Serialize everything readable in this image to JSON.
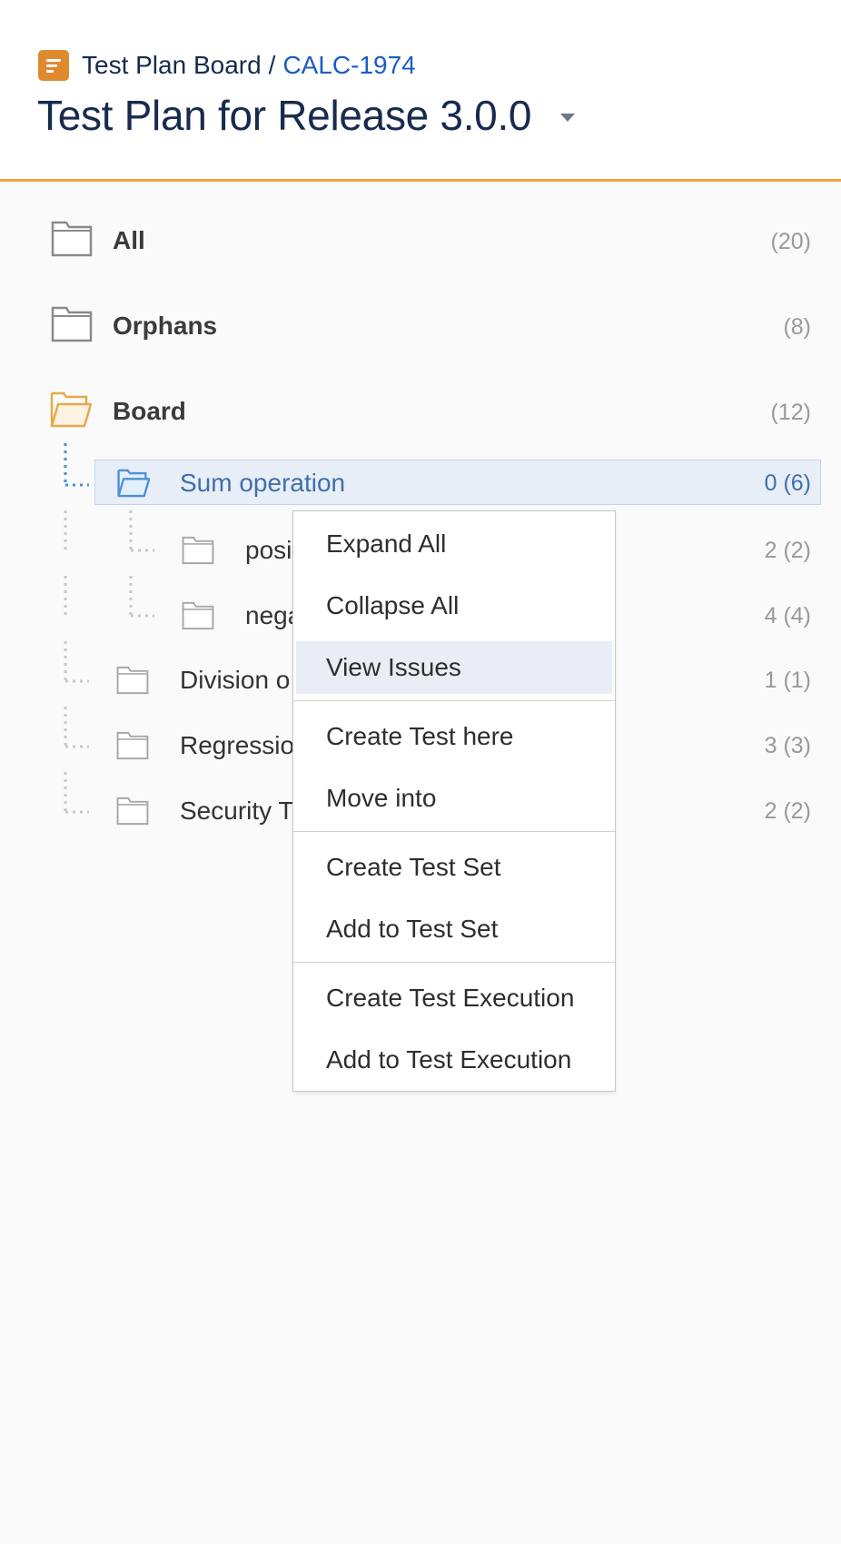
{
  "header": {
    "project_name": "Test Plan Board",
    "separator": "/",
    "issue_key": "CALC-1974",
    "title": "Test Plan for Release 3.0.0",
    "accent_color": "#f6a03c"
  },
  "tree": {
    "all": {
      "label": "All",
      "count": "(20)"
    },
    "orphans": {
      "label": "Orphans",
      "count": "(8)"
    },
    "board": {
      "label": "Board",
      "count": "(12)"
    },
    "folders": [
      {
        "label": "Sum operation",
        "count": "0 (6)"
      },
      {
        "label": "posi",
        "count": "2 (2)"
      },
      {
        "label": "nega",
        "count": "4 (4)"
      },
      {
        "label": "Division o",
        "count": "1 (1)"
      },
      {
        "label": "Regressio",
        "count": "3 (3)"
      },
      {
        "label": "Security T",
        "count": "2 (2)"
      }
    ]
  },
  "context_menu": {
    "items": [
      "Expand All",
      "Collapse All",
      "View Issues",
      "Create Test here",
      "Move into",
      "Create Test Set",
      "Add to Test Set",
      "Create Test Execution",
      "Add to Test Execution"
    ],
    "highlighted": "View Issues"
  }
}
